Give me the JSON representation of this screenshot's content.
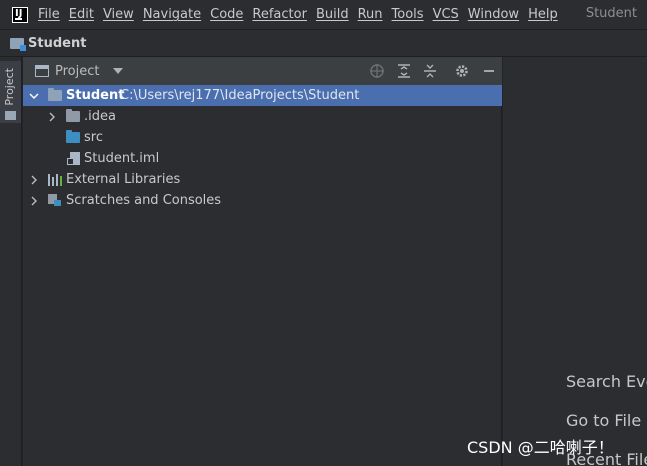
{
  "menubar": {
    "items": [
      "File",
      "Edit",
      "View",
      "Navigate",
      "Code",
      "Refactor",
      "Build",
      "Run",
      "Tools",
      "VCS",
      "Window",
      "Help"
    ],
    "window_title": "Student"
  },
  "navbar": {
    "project": "Student"
  },
  "toolstrip": {
    "tab_label": "Project"
  },
  "panel": {
    "title": "Project",
    "tree": {
      "root": {
        "name": "Student",
        "path": "C:\\Users\\rej177\\IdeaProjects\\Student"
      },
      "idea": ".idea",
      "src": "src",
      "iml": "Student.iml",
      "libraries": "External Libraries",
      "scratches": "Scratches and Consoles"
    }
  },
  "editor": {
    "hints": [
      "Search Eve",
      "Go to File",
      "Recent File"
    ]
  },
  "watermark": "CSDN @二哈喇子！"
}
